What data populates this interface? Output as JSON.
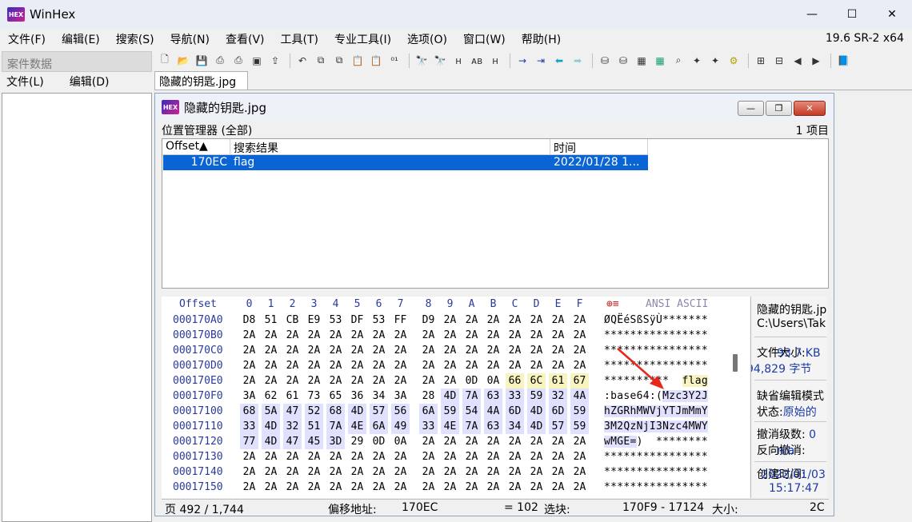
{
  "app": {
    "title": "WinHex",
    "icon_text": "HEX",
    "version": "19.6 SR-2 x64"
  },
  "window_controls": {
    "minimize": "—",
    "maximize": "☐",
    "close": "✕"
  },
  "menu": [
    "文件(F)",
    "编辑(E)",
    "搜索(S)",
    "导航(N)",
    "查看(V)",
    "工具(T)",
    "专业工具(I)",
    "选项(O)",
    "窗口(W)",
    "帮助(H)"
  ],
  "left_panel": {
    "header": "案件数据",
    "menu": [
      "文件(L)",
      "编辑(D)"
    ]
  },
  "doc_tab": "隐藏的钥匙.jpg",
  "docwin": {
    "title": "隐藏的钥匙.jpg",
    "buttons": {
      "minimize": "—",
      "restore": "❐",
      "close": "✕"
    }
  },
  "position_manager": {
    "title": "位置管理器 (全部)",
    "count": "1 项目",
    "columns": [
      "Offset▲",
      "搜索结果",
      "时间"
    ],
    "rows": [
      [
        "170EC",
        "flag",
        "2022/01/28  1..."
      ]
    ]
  },
  "hex": {
    "header_offset": "Offset",
    "header_cols": [
      "0",
      "1",
      "2",
      "3",
      "4",
      "5",
      "6",
      "7",
      "8",
      "9",
      "A",
      "B",
      "C",
      "D",
      "E",
      "F"
    ],
    "header_ascii": "ANSI ASCII",
    "rows": [
      {
        "offset": "000170A0",
        "bytes": [
          "D8",
          "51",
          "CB",
          "E9",
          "53",
          "DF",
          "53",
          "FF",
          "D9",
          "2A",
          "2A",
          "2A",
          "2A",
          "2A",
          "2A",
          "2A"
        ],
        "ascii": "ØQËéSßSÿÙ*******"
      },
      {
        "offset": "000170B0",
        "bytes": [
          "2A",
          "2A",
          "2A",
          "2A",
          "2A",
          "2A",
          "2A",
          "2A",
          "2A",
          "2A",
          "2A",
          "2A",
          "2A",
          "2A",
          "2A",
          "2A"
        ],
        "ascii": "****************"
      },
      {
        "offset": "000170C0",
        "bytes": [
          "2A",
          "2A",
          "2A",
          "2A",
          "2A",
          "2A",
          "2A",
          "2A",
          "2A",
          "2A",
          "2A",
          "2A",
          "2A",
          "2A",
          "2A",
          "2A"
        ],
        "ascii": "****************"
      },
      {
        "offset": "000170D0",
        "bytes": [
          "2A",
          "2A",
          "2A",
          "2A",
          "2A",
          "2A",
          "2A",
          "2A",
          "2A",
          "2A",
          "2A",
          "2A",
          "2A",
          "2A",
          "2A",
          "2A"
        ],
        "ascii": "****************"
      },
      {
        "offset": "000170E0",
        "bytes": [
          "2A",
          "2A",
          "2A",
          "2A",
          "2A",
          "2A",
          "2A",
          "2A",
          "2A",
          "2A",
          "0D",
          "0A",
          "66",
          "6C",
          "61",
          "67"
        ],
        "ascii_plain": "**********  ",
        "ascii_hl": "flag"
      },
      {
        "offset": "000170F0",
        "bytes": [
          "3A",
          "62",
          "61",
          "73",
          "65",
          "36",
          "34",
          "3A",
          "28",
          "4D",
          "7A",
          "63",
          "33",
          "59",
          "32",
          "4A"
        ],
        "ascii_plain": ":base64:(",
        "ascii_sel": "Mzc3Y2J"
      },
      {
        "offset": "00017100",
        "bytes": [
          "68",
          "5A",
          "47",
          "52",
          "68",
          "4D",
          "57",
          "56",
          "6A",
          "59",
          "54",
          "4A",
          "6D",
          "4D",
          "6D",
          "59"
        ],
        "ascii_sel": "hZGRhMWVjYTJmMmY"
      },
      {
        "offset": "00017110",
        "bytes": [
          "33",
          "4D",
          "32",
          "51",
          "7A",
          "4E",
          "6A",
          "49",
          "33",
          "4E",
          "7A",
          "63",
          "34",
          "4D",
          "57",
          "59"
        ],
        "ascii_sel": "3M2QzNjI3Nzc4MWY"
      },
      {
        "offset": "00017120",
        "bytes": [
          "77",
          "4D",
          "47",
          "45",
          "3D",
          "29",
          "0D",
          "0A",
          "2A",
          "2A",
          "2A",
          "2A",
          "2A",
          "2A",
          "2A",
          "2A"
        ],
        "ascii_sel": "wMGE=",
        "ascii_plain": ")  ********"
      },
      {
        "offset": "00017130",
        "bytes": [
          "2A",
          "2A",
          "2A",
          "2A",
          "2A",
          "2A",
          "2A",
          "2A",
          "2A",
          "2A",
          "2A",
          "2A",
          "2A",
          "2A",
          "2A",
          "2A"
        ],
        "ascii": "****************"
      },
      {
        "offset": "00017140",
        "bytes": [
          "2A",
          "2A",
          "2A",
          "2A",
          "2A",
          "2A",
          "2A",
          "2A",
          "2A",
          "2A",
          "2A",
          "2A",
          "2A",
          "2A",
          "2A",
          "2A"
        ],
        "ascii": "****************"
      },
      {
        "offset": "00017150",
        "bytes": [
          "2A",
          "2A",
          "2A",
          "2A",
          "2A",
          "2A",
          "2A",
          "2A",
          "2A",
          "2A",
          "2A",
          "2A",
          "2A",
          "2A",
          "2A",
          "2A"
        ],
        "ascii": "****************"
      }
    ]
  },
  "info": {
    "filename": "隐藏的钥匙.jp",
    "path": "C:\\Users\\Tak",
    "size_label": "文件大小:",
    "size_value": "93.7 KB",
    "size_bytes": "94,829 字节",
    "edit_mode_label": "缺省编辑模式",
    "state_label": "状态:",
    "state_value": "原始的",
    "undo_label": "撤消级数:",
    "undo_value": "0",
    "reverse_label": "反向撤消:",
    "reverse_value": "n/a",
    "created_label": "创建时间:",
    "created_date": "2022/01/03",
    "created_time": "15:17:47"
  },
  "status": {
    "page": "页 492 / 1,744",
    "offset_label": "偏移地址:",
    "offset_value": "170EC",
    "eq_value": "= 102",
    "block_label": "选块:",
    "block_value": "170F9 - 17124",
    "size_label": "大小:",
    "size_value": "2C"
  }
}
